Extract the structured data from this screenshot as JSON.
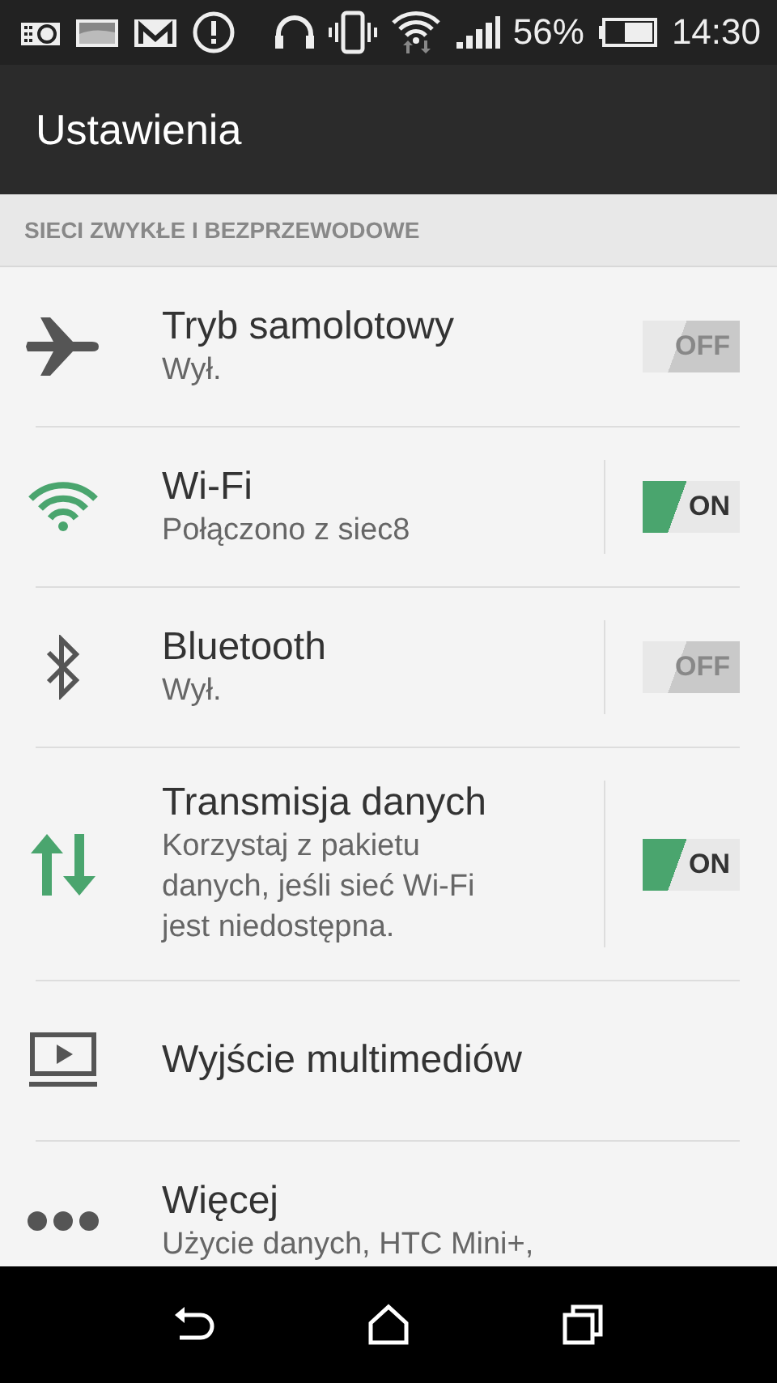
{
  "status_bar": {
    "battery": "56%",
    "time": "14:30"
  },
  "header": {
    "title": "Ustawienia"
  },
  "section": {
    "title": "SIECI ZWYKŁE I BEZPRZEWODOWE"
  },
  "items": [
    {
      "kind": "toggle",
      "title": "Tryb samolotowy",
      "subtitle": "Wył.",
      "on": false,
      "switch_label": "OFF",
      "split": false
    },
    {
      "kind": "toggle",
      "title": "Wi-Fi",
      "subtitle": "Połączono z siec8",
      "on": true,
      "switch_label": "ON",
      "split": true
    },
    {
      "kind": "toggle",
      "title": "Bluetooth",
      "subtitle": "Wył.",
      "on": false,
      "switch_label": "OFF",
      "split": true
    },
    {
      "kind": "toggle",
      "title": "Transmisja danych",
      "subtitle": "Korzystaj z pakietu danych, jeśli sieć Wi-Fi jest niedostępna.",
      "on": true,
      "switch_label": "ON",
      "split": true
    },
    {
      "kind": "link",
      "title": "Wyjście multimediów"
    },
    {
      "kind": "link",
      "title": "Więcej",
      "subtitle": "Użycie danych, HTC Mini+,"
    }
  ]
}
